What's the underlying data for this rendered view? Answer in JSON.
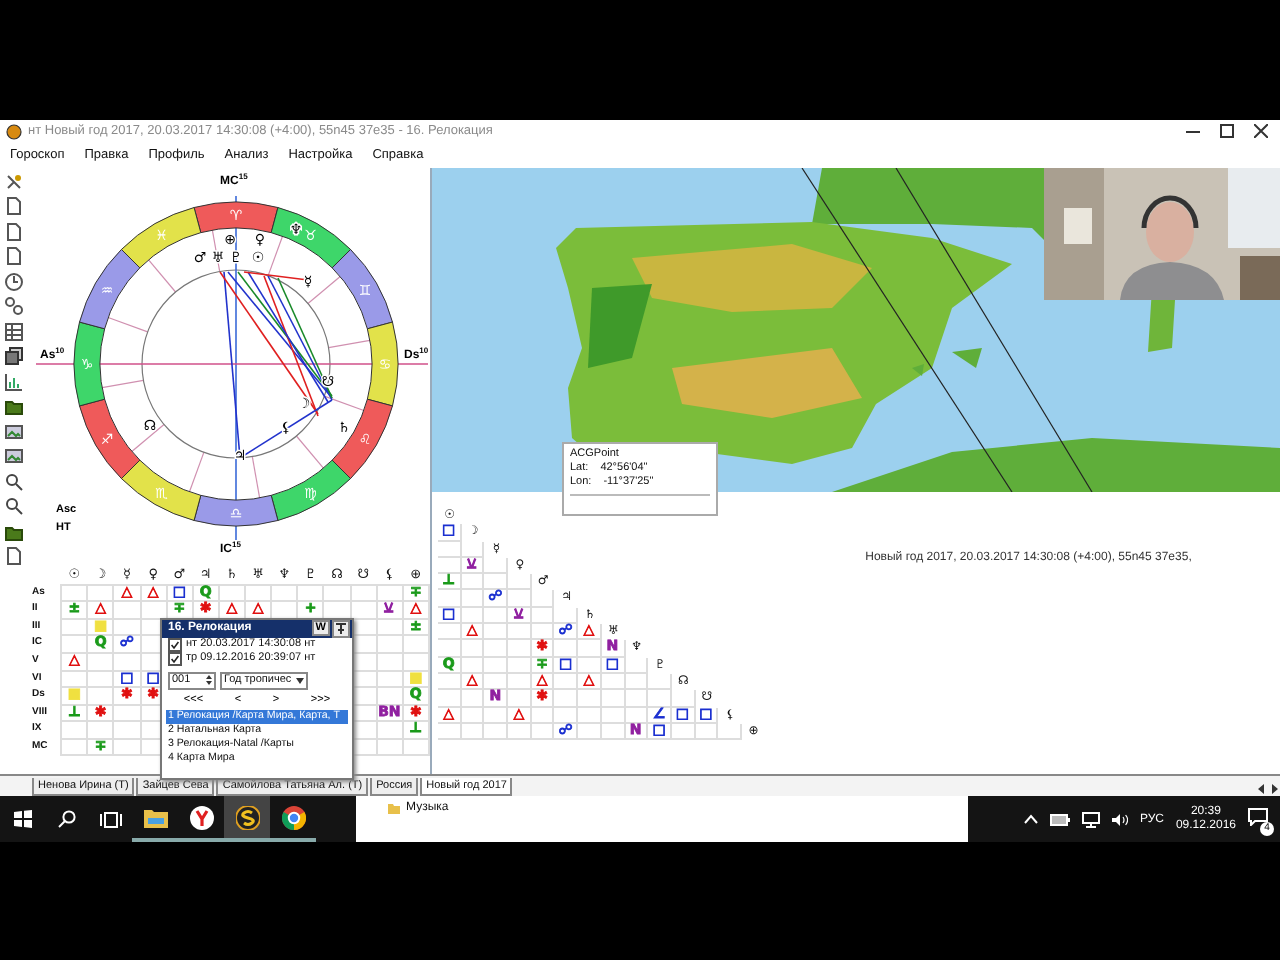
{
  "window": {
    "title": "нт Новый год 2017, 20.03.2017 14:30:08 (+4:00), 55n45 37e35 - 16. Релокация"
  },
  "menu": [
    "Гороскоп",
    "Правка",
    "Профиль",
    "Анализ",
    "Настройка",
    "Справка"
  ],
  "wheel": {
    "angles": [
      {
        "label": "MC",
        "degree": "15"
      },
      {
        "label": "Ds",
        "degree": "10"
      },
      {
        "label": "IC",
        "degree": "15"
      },
      {
        "label": "As",
        "degree": "10"
      }
    ],
    "signs": [
      {
        "g": "♈",
        "color": "#ef5a5a"
      },
      {
        "g": "♉",
        "color": "#3ed66a"
      },
      {
        "g": "♊",
        "color": "#9a9ae8"
      },
      {
        "g": "♋",
        "color": "#e2e24a"
      },
      {
        "g": "♌",
        "color": "#ef5a5a"
      },
      {
        "g": "♍",
        "color": "#3ed66a"
      },
      {
        "g": "♎",
        "color": "#9a9ae8"
      },
      {
        "g": "♏",
        "color": "#e2e24a"
      },
      {
        "g": "♐",
        "color": "#ef5a5a"
      },
      {
        "g": "♑",
        "color": "#3ed66a"
      },
      {
        "g": "♒",
        "color": "#9a9ae8"
      },
      {
        "g": "♓",
        "color": "#e2e24a"
      }
    ],
    "planets": [
      "♆",
      "⊕",
      "♀",
      "♂",
      "♅",
      "♇",
      "☉",
      "☿",
      "☋",
      "☽",
      "☊",
      "⚸",
      "♄",
      "♃"
    ],
    "footer": [
      "Asc",
      "НТ"
    ]
  },
  "aspect_table": {
    "columns": [
      "☉",
      "☽",
      "☿",
      "♀",
      "♂",
      "♃",
      "♄",
      "♅",
      "♆",
      "♇",
      "☊",
      "☋",
      "⚸",
      "⊕"
    ],
    "rows": [
      {
        "label": "As",
        "cells": [
          null,
          null,
          {
            "t": "△",
            "color": "#e01010"
          },
          {
            "t": "△",
            "color": "#e01010"
          },
          {
            "t": "□",
            "color": "#1a2fd0"
          },
          {
            "t": "Q",
            "color": "#1a9a1a"
          },
          null,
          null,
          null,
          null,
          null,
          null,
          null,
          {
            "t": "∓",
            "color": "#1a9a1a"
          }
        ]
      },
      {
        "label": "II",
        "cells": [
          {
            "t": "±",
            "color": "#1a9a1a"
          },
          {
            "t": "△",
            "color": "#e01010"
          },
          null,
          null,
          {
            "t": "∓",
            "color": "#1a9a1a"
          },
          {
            "t": "✱",
            "color": "#e01010"
          },
          {
            "t": "△",
            "color": "#e01010"
          },
          {
            "t": "△",
            "color": "#e01010"
          },
          null,
          {
            "t": "+",
            "color": "#1a9a1a"
          },
          null,
          null,
          {
            "t": "⚺",
            "color": "#9020a0"
          },
          {
            "t": "△",
            "color": "#e01010"
          }
        ]
      },
      {
        "label": "III",
        "cells": [
          null,
          {
            "t": "■",
            "color": "#f0e040"
          },
          null,
          null,
          null,
          null,
          null,
          null,
          null,
          null,
          null,
          null,
          null,
          {
            "t": "±",
            "color": "#1a9a1a"
          }
        ]
      },
      {
        "label": "IC",
        "cells": [
          null,
          {
            "t": "Q",
            "color": "#1a9a1a"
          },
          {
            "t": "☍",
            "color": "#1a2fd0"
          },
          null,
          null,
          null,
          null,
          null,
          null,
          null,
          null,
          null,
          null,
          null
        ]
      },
      {
        "label": "V",
        "cells": [
          {
            "t": "△",
            "color": "#e01010"
          },
          null,
          null,
          null,
          null,
          null,
          null,
          null,
          null,
          null,
          null,
          null,
          null,
          null
        ]
      },
      {
        "label": "VI",
        "cells": [
          null,
          null,
          {
            "t": "□",
            "color": "#1a2fd0"
          },
          {
            "t": "□",
            "color": "#1a2fd0"
          },
          null,
          null,
          null,
          null,
          null,
          null,
          null,
          null,
          null,
          {
            "t": "■",
            "color": "#f0e040"
          }
        ]
      },
      {
        "label": "Ds",
        "cells": [
          {
            "t": "■",
            "color": "#f0e040"
          },
          null,
          {
            "t": "✱",
            "color": "#e01010"
          },
          {
            "t": "✱",
            "color": "#e01010"
          },
          null,
          null,
          null,
          null,
          null,
          null,
          null,
          null,
          null,
          {
            "t": "Q",
            "color": "#1a9a1a"
          }
        ]
      },
      {
        "label": "VIII",
        "cells": [
          {
            "t": "⊥",
            "color": "#1a9a1a"
          },
          {
            "t": "✱",
            "color": "#e01010"
          },
          null,
          null,
          null,
          null,
          null,
          null,
          null,
          null,
          null,
          null,
          {
            "t": "BN",
            "color": "#9020a0"
          },
          {
            "t": "✱",
            "color": "#e01010"
          }
        ]
      },
      {
        "label": "IX",
        "cells": [
          null,
          null,
          null,
          null,
          null,
          null,
          null,
          null,
          null,
          null,
          null,
          null,
          null,
          {
            "t": "⊥",
            "color": "#1a9a1a"
          }
        ]
      },
      {
        "label": "MC",
        "cells": [
          null,
          {
            "t": "∓",
            "color": "#1a9a1a"
          },
          null,
          null,
          null,
          null,
          null,
          null,
          null,
          null,
          null,
          null,
          null,
          null
        ]
      }
    ]
  },
  "relocation_panel": {
    "title": "16. Релокация",
    "w_button": "W",
    "charts": [
      {
        "label": "нт 20.03.2017 14:30:08 нт",
        "checked": true
      },
      {
        "label": "тр 09.12.2016 20:39:07 нт",
        "checked": true
      }
    ],
    "step": "001",
    "mode": "Год тропичес",
    "nav": [
      "<<<",
      "<",
      ">",
      ">>>"
    ],
    "items": [
      {
        "label": "1 Релокация /Карта Мира, Карта, Т",
        "selected": true
      },
      {
        "label": "2 Натальная Карта",
        "selected": false
      },
      {
        "label": "3 Релокация-Natal /Карты",
        "selected": false
      },
      {
        "label": "4 Карта Мира",
        "selected": false
      }
    ]
  },
  "map": {
    "kind": "picture"
  },
  "webcam": {
    "kind": "picture"
  },
  "acg_point": {
    "title": "ACGPoint",
    "rows": [
      {
        "label": "Lat:",
        "value": "42°56'04\""
      },
      {
        "label": "Lon:",
        "value": "-11°37'25\""
      }
    ]
  },
  "aspect_grid": {
    "rows": [
      {
        "planet": "☉",
        "cells": []
      },
      {
        "planet": "☽",
        "cells": [
          {
            "t": "□",
            "color": "#1a2fd0"
          }
        ]
      },
      {
        "planet": "☿",
        "cells": [
          null,
          null
        ]
      },
      {
        "planet": "♀",
        "cells": [
          null,
          {
            "t": "⚺",
            "color": "#9020a0"
          },
          null
        ]
      },
      {
        "planet": "♂",
        "cells": [
          {
            "t": "⊥",
            "color": "#1a9a1a"
          },
          null,
          null,
          null
        ]
      },
      {
        "planet": "♃",
        "cells": [
          null,
          null,
          {
            "t": "☍",
            "color": "#1a2fd0"
          },
          null,
          null
        ]
      },
      {
        "planet": "♄",
        "cells": [
          {
            "t": "□",
            "color": "#1a2fd0"
          },
          null,
          null,
          {
            "t": "⚺",
            "color": "#9020a0"
          },
          null,
          null
        ]
      },
      {
        "planet": "♅",
        "cells": [
          null,
          {
            "t": "△",
            "color": "#e01010"
          },
          null,
          null,
          null,
          {
            "t": "☍",
            "color": "#1a2fd0"
          },
          {
            "t": "△",
            "color": "#e01010"
          }
        ]
      },
      {
        "planet": "♆",
        "cells": [
          null,
          null,
          null,
          null,
          {
            "t": "✱",
            "color": "#e01010"
          },
          null,
          null,
          {
            "t": "N",
            "color": "#9020a0"
          }
        ]
      },
      {
        "planet": "♇",
        "cells": [
          {
            "t": "Q",
            "color": "#1a9a1a"
          },
          null,
          null,
          null,
          {
            "t": "∓",
            "color": "#1a9a1a"
          },
          {
            "t": "□",
            "color": "#1a2fd0"
          },
          null,
          {
            "t": "□",
            "color": "#1a2fd0"
          },
          null
        ]
      },
      {
        "planet": "☊",
        "cells": [
          null,
          {
            "t": "△",
            "color": "#e01010"
          },
          null,
          null,
          {
            "t": "△",
            "color": "#e01010"
          },
          null,
          {
            "t": "△",
            "color": "#e01010"
          },
          null,
          null,
          null
        ]
      },
      {
        "planet": "☋",
        "cells": [
          null,
          null,
          {
            "t": "N",
            "color": "#9020a0"
          },
          null,
          {
            "t": "✱",
            "color": "#e01010"
          },
          null,
          null,
          null,
          null,
          null,
          null
        ]
      },
      {
        "planet": "⚸",
        "cells": [
          {
            "t": "△",
            "color": "#e01010"
          },
          null,
          null,
          {
            "t": "△",
            "color": "#e01010"
          },
          null,
          null,
          null,
          null,
          null,
          {
            "t": "∠",
            "color": "#1a2fd0"
          },
          {
            "t": "□",
            "color": "#1a2fd0"
          },
          {
            "t": "□",
            "color": "#1a2fd0"
          }
        ]
      },
      {
        "planet": "⊕",
        "cells": [
          null,
          null,
          null,
          null,
          null,
          {
            "t": "☍",
            "color": "#1a2fd0"
          },
          null,
          null,
          {
            "t": "N",
            "color": "#9020a0"
          },
          {
            "t": "□",
            "color": "#1a2fd0"
          },
          null,
          null,
          null
        ]
      }
    ]
  },
  "caption": "Новый год 2017, 20.03.2017 14:30:08 (+4:00), 55n45 37e35,",
  "tabs": [
    {
      "label": "Ненова Ирина (Т)",
      "selected": false
    },
    {
      "label": "Зайцев Сева",
      "selected": false
    },
    {
      "label": "Самойлова Татьяна Ал. (Т)",
      "selected": false
    },
    {
      "label": "Россия",
      "selected": false
    },
    {
      "label": "Новый год 2017",
      "selected": true
    }
  ],
  "taskbar": {
    "apps": [
      {
        "kind": "folder",
        "active": false
      },
      {
        "kind": "browser",
        "active": false
      },
      {
        "kind": "astro",
        "active": true
      },
      {
        "kind": "chrome",
        "active": false
      }
    ],
    "jump_list": [
      "Музыка"
    ],
    "language": "РУС",
    "time": "20:39",
    "date": "09.12.2016",
    "notifications": "4"
  }
}
